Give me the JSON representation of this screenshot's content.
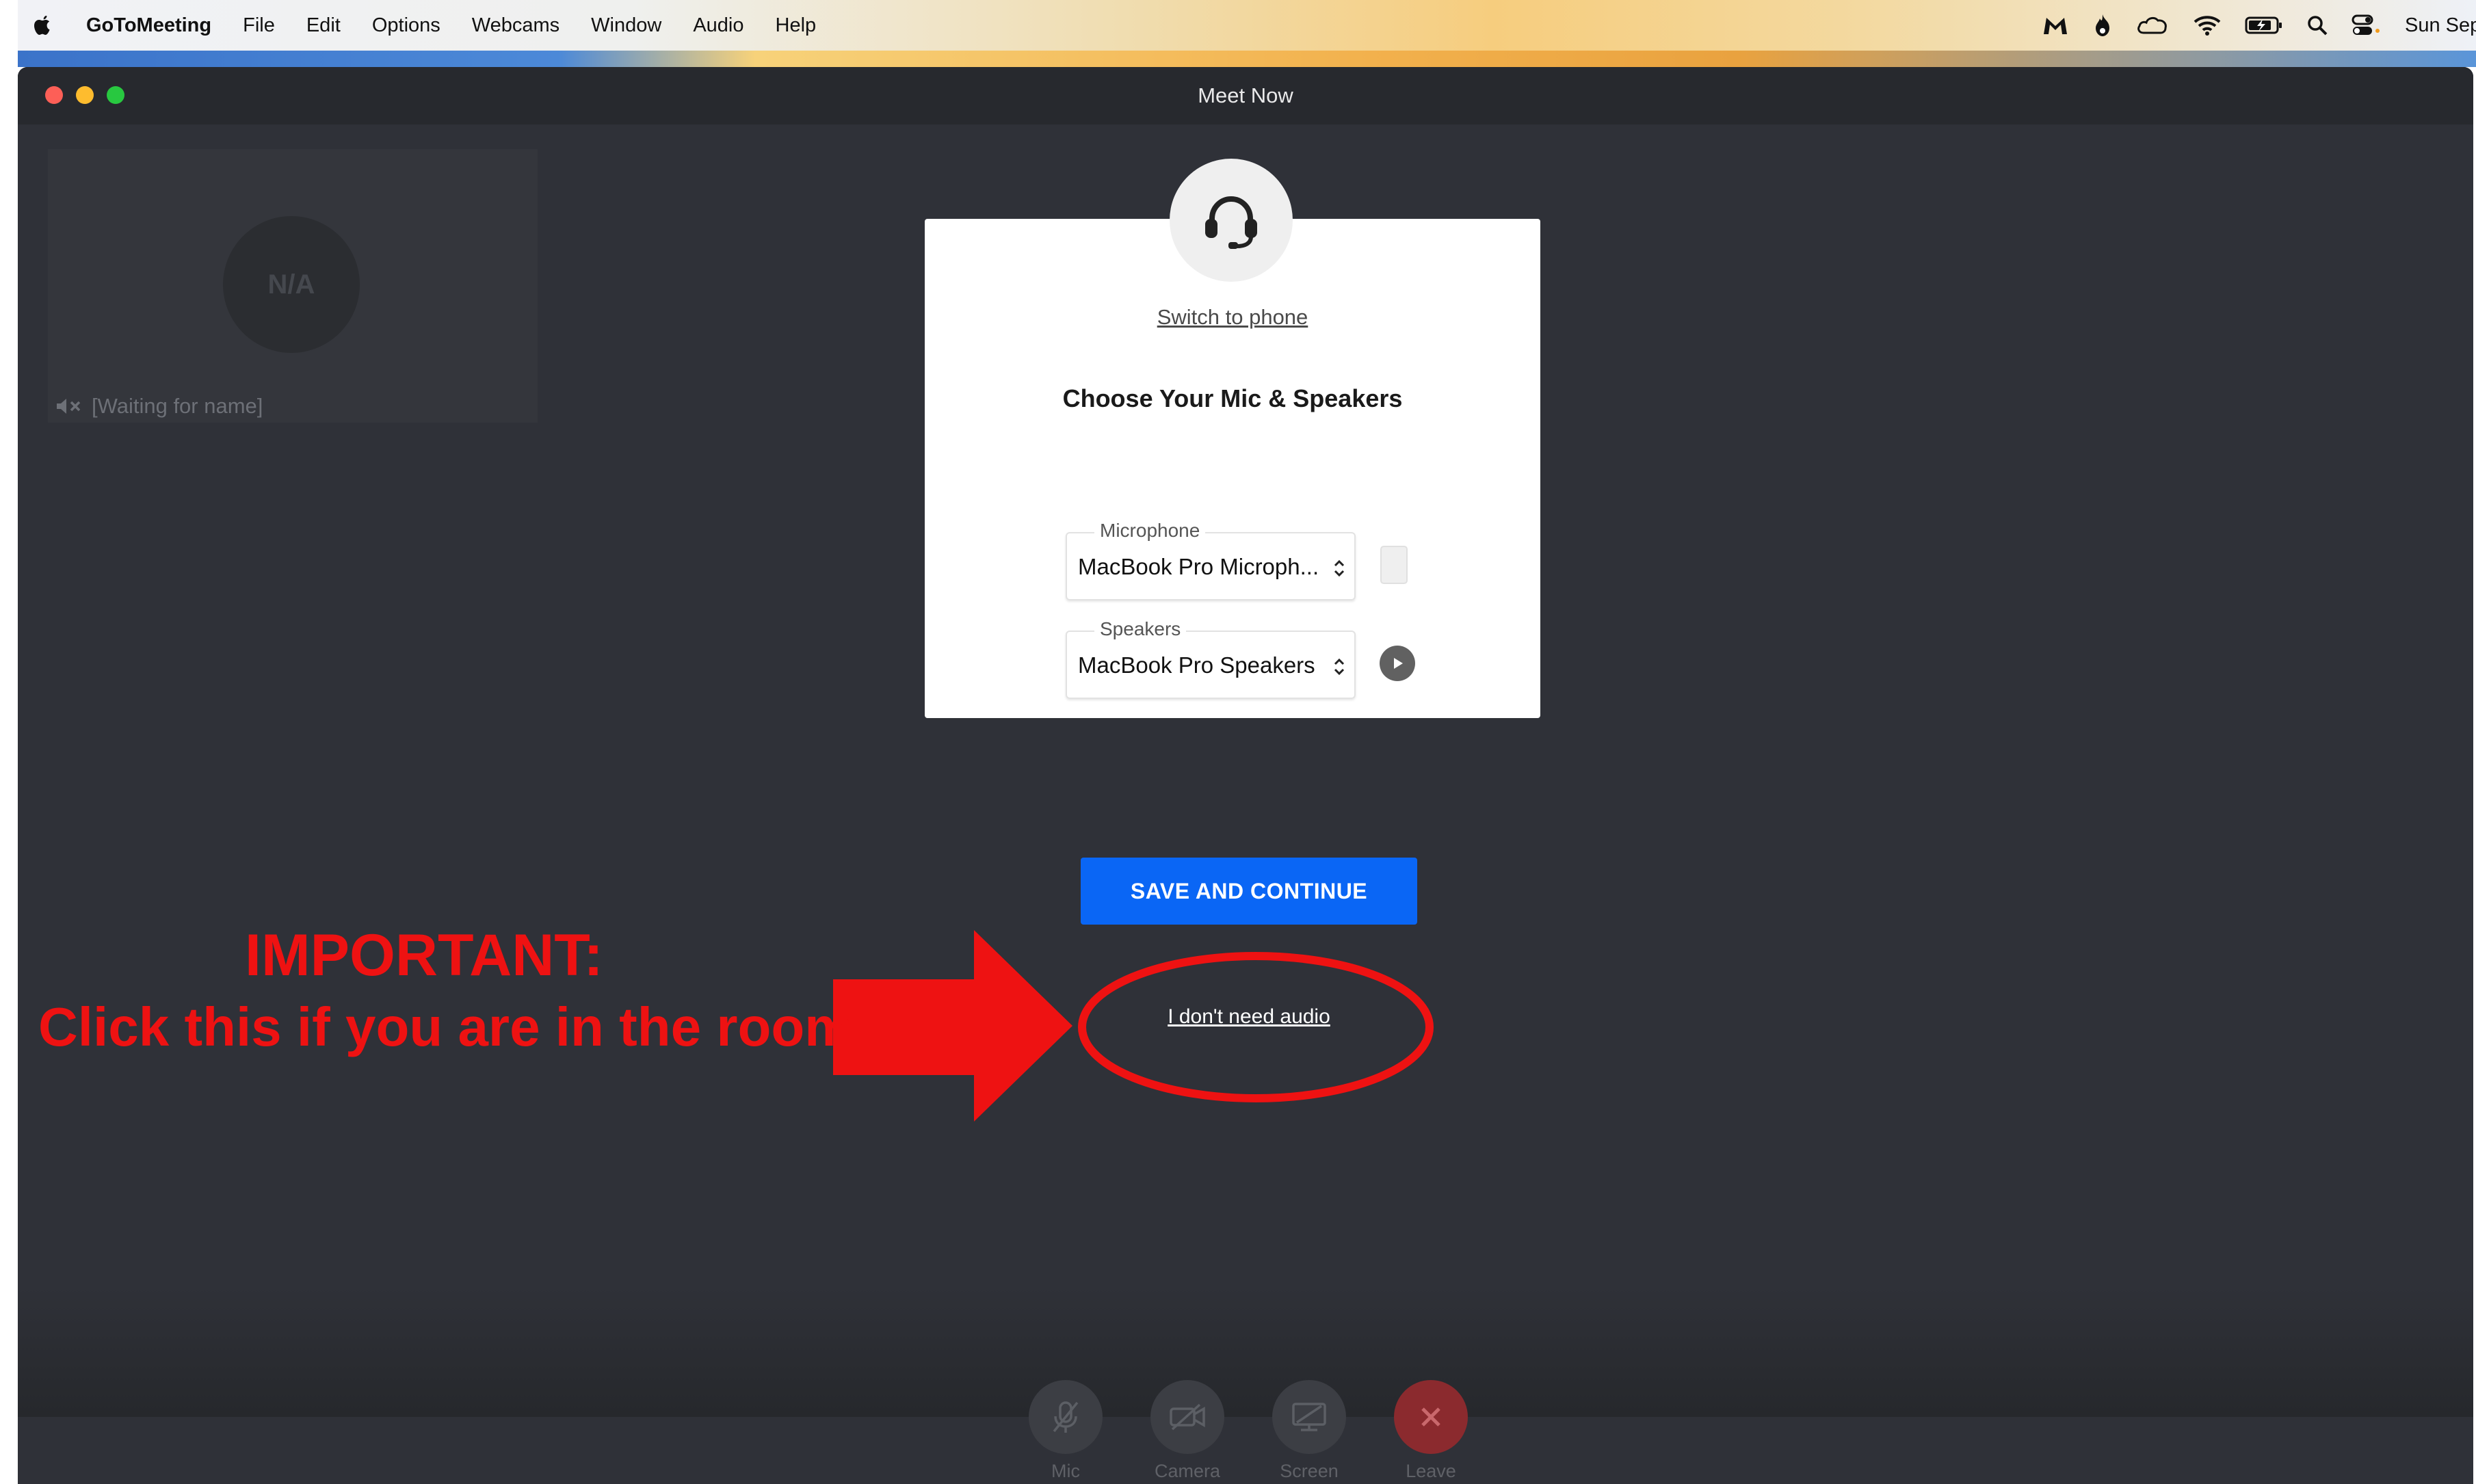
{
  "menubar": {
    "app_name": "GoToMeeting",
    "items": [
      "File",
      "Edit",
      "Options",
      "Webcams",
      "Window",
      "Audio",
      "Help"
    ],
    "clock": "Sun Sep"
  },
  "window": {
    "title": "Meet Now"
  },
  "participant": {
    "initials": "N/A",
    "name": "[Waiting for name]"
  },
  "audio_dialog": {
    "switch_link": "Switch to phone",
    "title": "Choose Your Mic & Speakers",
    "microphone": {
      "label": "Microphone",
      "value": "MacBook Pro Microph..."
    },
    "speakers": {
      "label": "Speakers",
      "value": "MacBook Pro Speakers"
    },
    "save_button": "SAVE AND CONTINUE",
    "no_audio_link": "I don't need audio"
  },
  "annotation": {
    "title": "IMPORTANT:",
    "subtitle": "Click this if you are in the room!",
    "color": "#ee1212"
  },
  "toolbar": {
    "mic": "Mic",
    "camera": "Camera",
    "screen": "Screen",
    "leave": "Leave"
  },
  "colors": {
    "primary_button": "#0a66f5",
    "window_bg": "#2f3138",
    "leave": "#8b2a2e"
  },
  "icons": [
    "apple-logo-icon",
    "malwarebytes-icon",
    "flame-icon",
    "cloud-sync-icon",
    "wifi-icon",
    "battery-icon",
    "search-icon",
    "control-center-icon",
    "headset-icon",
    "chevron-updown-icon",
    "play-icon",
    "speaker-muted-icon",
    "mic-off-icon",
    "camera-off-icon",
    "screen-share-off-icon",
    "close-icon"
  ]
}
